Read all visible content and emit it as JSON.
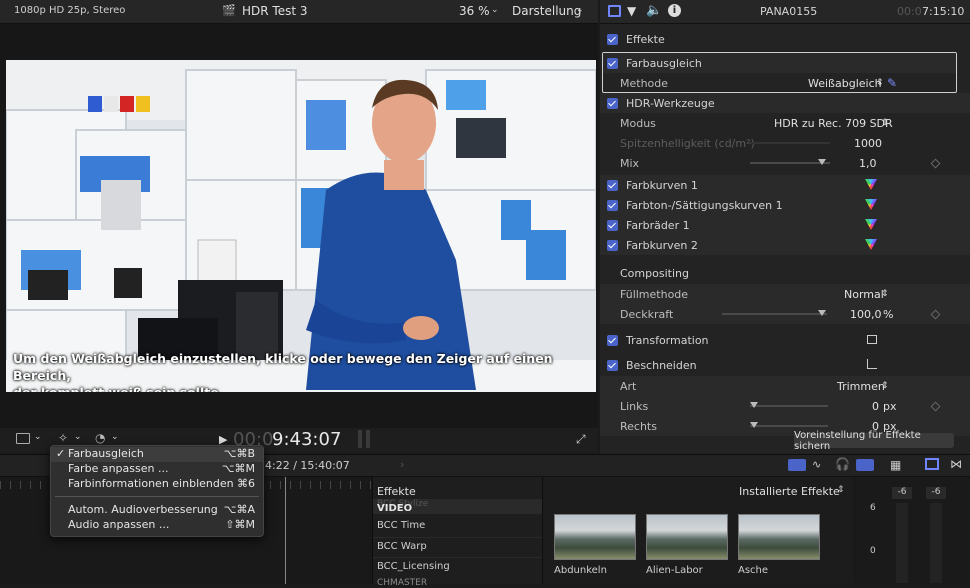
{
  "viewer": {
    "format": "1080p HD 25p, Stereo",
    "project_title": "HDR Test 3",
    "zoom": "36 %",
    "display_menu": "Darstellung",
    "timecode_dim": "00:0",
    "timecode_main": "9:43:07",
    "subtitle_line1": "Um den Weißabgleich einzustellen, klicke oder bewege den Zeiger auf einen Bereich,",
    "subtitle_line2": "der komplett weiß sein sollte."
  },
  "inspector": {
    "clip_name": "PANA0155",
    "timecode_dim": "00:0",
    "timecode_main": "7:15:10",
    "sections": {
      "effects": "Effekte",
      "color_balance": "Farbausgleich",
      "method_label": "Methode",
      "method_value": "Weißabgleich",
      "hdr_tools": "HDR-Werkzeuge",
      "mode_label": "Modus",
      "mode_value": "HDR zu Rec. 709 SDR",
      "peak_label": "Spitzenhelligkeit (cd/m²)",
      "peak_value": "1000",
      "mix_label": "Mix",
      "mix_value": "1,0",
      "curves1": "Farbkurven 1",
      "hue_sat": "Farbton-/Sättigungskurven 1",
      "wheels": "Farbräder 1",
      "curves2": "Farbkurven 2",
      "compositing": "Compositing",
      "blend_label": "Füllmethode",
      "blend_value": "Normal",
      "opacity_label": "Deckkraft",
      "opacity_value": "100,0",
      "opacity_unit": "%",
      "transform": "Transformation",
      "crop": "Beschneiden",
      "type_label": "Art",
      "type_value": "Trimmen",
      "left_label": "Links",
      "left_value": "0",
      "left_unit": "px",
      "right_label": "Rechts",
      "right_value": "0",
      "right_unit": "px"
    },
    "save_preset": "Voreinstellung für Effekte sichern"
  },
  "menu": {
    "items": [
      {
        "label": "Farbausgleich",
        "shortcut": "⌥⌘B",
        "checked": "✓"
      },
      {
        "label": "Farbe anpassen ...",
        "shortcut": "⌥⌘M"
      },
      {
        "label": "Farbinformationen einblenden",
        "shortcut": "⌘6"
      },
      {
        "label": "Autom. Audioverbesserung",
        "shortcut": "⌥⌘A"
      },
      {
        "label": "Audio anpassen ...",
        "shortcut": "⇧⌘M"
      }
    ]
  },
  "timeline": {
    "timecode": "4:22 / 15:40:07"
  },
  "effects_browser": {
    "title": "Effekte",
    "installed": "Installierte Effekte",
    "categories": [
      "BCC Stylize",
      "VIDEO",
      "BCC Time",
      "BCC Warp",
      "BCC_Licensing",
      "CHMASTER"
    ],
    "thumbs": [
      "Abdunkeln",
      "Alien-Labor",
      "Asche"
    ]
  },
  "meters": {
    "left": "-6",
    "right": "-6",
    "scale_top": "6",
    "scale_zero": "0"
  },
  "colors": {
    "accent": "#4b64c9",
    "bg": "#1b1b1b"
  }
}
